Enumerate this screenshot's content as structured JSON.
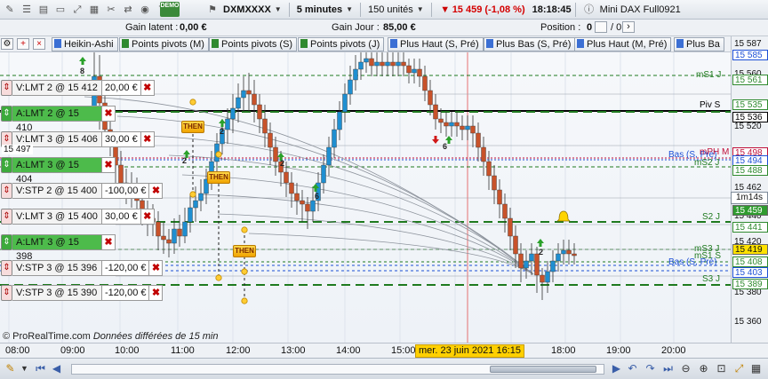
{
  "toolbar": {
    "demo_label": "DEMO",
    "instrument": "DXMXXXX",
    "timeframe": "5 minutes",
    "units": "150 unités",
    "price_change": "15 459 (-1,08 %)",
    "clock": "18:18:45",
    "contract": "Mini DAX Full0921"
  },
  "infobar": {
    "latent_label": "Gain latent :",
    "latent_value": "0,00 €",
    "day_label": "Gain Jour :",
    "day_value": "85,00 €",
    "position_label": "Position :",
    "position_value": "0",
    "position_fraction": "/ 0"
  },
  "indicator_tabs": [
    {
      "label": "Heikin-Ashi",
      "color": "#3b6fd4"
    },
    {
      "label": "Points pivots (M)",
      "color": "#2f8a2f"
    },
    {
      "label": "Points pivots (S)",
      "color": "#2f8a2f"
    },
    {
      "label": "Points pivots (J)",
      "color": "#2f8a2f"
    },
    {
      "label": "Plus Haut (S, Pré)",
      "color": "#3b6fd4"
    },
    {
      "label": "Plus Bas (S, Pré)",
      "color": "#3b6fd4"
    },
    {
      "label": "Plus Haut (M, Pré)",
      "color": "#3b6fd4"
    },
    {
      "label": "Plus Ba",
      "color": "#3b6fd4"
    }
  ],
  "orders": [
    {
      "type": "sell",
      "label": "V:LMT  2 @ 15 412",
      "amount": "20,00 €",
      "active": false
    },
    {
      "type": "buy",
      "label": "A:LMT  2 @ 15 410",
      "amount": "",
      "active": true
    },
    {
      "type": "sell",
      "label": "V:LMT  3 @ 15 406",
      "amount": "30,00 €",
      "active": false
    },
    {
      "type": "buy",
      "label": "A:LMT  3 @ 15 404",
      "amount": "",
      "active": true
    },
    {
      "type": "sell",
      "label": "V:STP  2 @ 15 400",
      "amount": "-100,00 €",
      "active": false
    },
    {
      "type": "sell",
      "label": "V:LMT  3 @ 15 400",
      "amount": "30,00 €",
      "active": false
    },
    {
      "type": "buy",
      "label": "A:LMT  3 @ 15 398",
      "amount": "",
      "active": true
    },
    {
      "type": "sell",
      "label": "V:STP  3 @ 15 396",
      "amount": "-120,00 €",
      "active": false
    },
    {
      "type": "sell",
      "label": "V:STP  3 @ 15 390",
      "amount": "-120,00 €",
      "active": false
    }
  ],
  "then_label": "THEN",
  "delay_note": {
    "brand": "© ProRealTime.com",
    "text": "Données différées de 15 min"
  },
  "left_price_tag": "15 497",
  "price_axis": {
    "ticks": [
      "15 587",
      "15 560",
      "15 536",
      "15 520",
      "15 480",
      "15 462",
      "15 440",
      "15 420",
      "15 400",
      "15 380",
      "15 360"
    ],
    "tags": [
      {
        "text": "15 585",
        "bg": "#ffffff",
        "fg": "#1c4fd6"
      },
      {
        "text": "15 561",
        "bg": "#ffffff",
        "fg": "#2f8a2f"
      },
      {
        "text": "15 536",
        "bg": "#ffffff",
        "fg": "#000000"
      },
      {
        "text": "15 535",
        "bg": "#ffffff",
        "fg": "#2f8a2f"
      },
      {
        "text": "15 498",
        "bg": "#ffffff",
        "fg": "#c0103a"
      },
      {
        "text": "15 494",
        "bg": "#ffffff",
        "fg": "#1c4fd6"
      },
      {
        "text": "15 488",
        "bg": "#ffffff",
        "fg": "#2f8a2f"
      },
      {
        "text": "15 459",
        "bg": "#2f9b2f",
        "fg": "#ffffff"
      },
      {
        "text": "15 441",
        "bg": "#ffffff",
        "fg": "#2f8a2f"
      },
      {
        "text": "15 419",
        "bg": "#ffe100",
        "fg": "#111111"
      },
      {
        "text": "15 408",
        "bg": "#ffffff",
        "fg": "#2f8a2f"
      },
      {
        "text": "15 403",
        "bg": "#ffffff",
        "fg": "#1c4fd6"
      },
      {
        "text": "15 389",
        "bg": "#ffffff",
        "fg": "#2f8a2f"
      }
    ],
    "timer": "1m14s"
  },
  "level_labels": [
    "mS1 J",
    "Piv S",
    "Bas (S, Pré)",
    "mPH M",
    "mS2 J",
    "S2 J",
    "mS3 J",
    "mS1 S",
    "Bas (S, Pré)",
    "S3 J"
  ],
  "signal_counts": [
    "8",
    "2",
    "2",
    "2",
    "6",
    "6",
    "2"
  ],
  "time_axis": {
    "labels": [
      "08:00",
      "09:00",
      "10:00",
      "11:00",
      "12:00",
      "13:00",
      "14:00",
      "15:00",
      "18:00",
      "19:00",
      "20:00"
    ],
    "cursor_date": "mer. 23 juin 2021 16:15"
  },
  "colors": {
    "bull": "#1f8fd1",
    "bear": "#c8522a",
    "dashed_green": "#1f7a1f",
    "pivot": "#000000",
    "cursor_line": "#e03a3a"
  }
}
